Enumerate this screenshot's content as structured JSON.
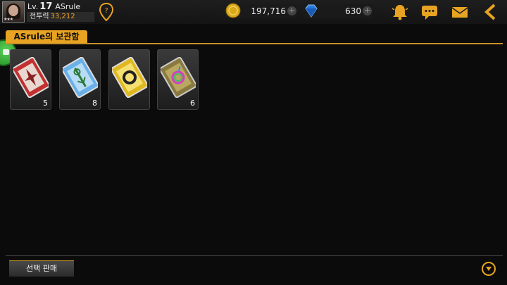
{
  "player": {
    "level_prefix": "Lv.",
    "level": "17",
    "name": "ASrule",
    "power_label": "전투력",
    "power_value": "33,212",
    "rank_stars": "★★★"
  },
  "currency": {
    "gold": "197,716",
    "gems": "630",
    "plus_symbol": "+"
  },
  "panel": {
    "title": "ASrule의 보관함"
  },
  "items": [
    {
      "name": "red-ticket",
      "count": "5",
      "color": "#b02a2a"
    },
    {
      "name": "blue-ticket",
      "count": "8",
      "color": "#5aa0d8"
    },
    {
      "name": "gold-ticket",
      "count": "",
      "color": "#d8b020"
    },
    {
      "name": "rainbow-ticket",
      "count": "6",
      "color": "#8a7a3a"
    }
  ],
  "bottom": {
    "sell_label": "선택 판매"
  },
  "colors": {
    "accent": "#e7a321",
    "background": "#0b0b0b"
  }
}
